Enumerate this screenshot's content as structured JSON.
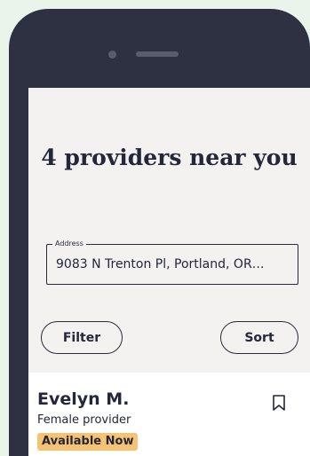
{
  "header": {
    "title": "4 providers near you"
  },
  "address": {
    "label": "Address",
    "value": "9083 N Trenton Pl, Portland, OR…"
  },
  "controls": {
    "filter_label": "Filter",
    "sort_label": "Sort"
  },
  "provider": {
    "name": "Evelyn M.",
    "gender": "Female provider",
    "availability": "Available Now",
    "bookmark_icon": "bookmark-icon"
  },
  "colors": {
    "background": "#eaf4ea",
    "phone": "#2d3142",
    "screen": "#f4f2f1",
    "badge": "#f6c274",
    "text": "#24263a"
  }
}
